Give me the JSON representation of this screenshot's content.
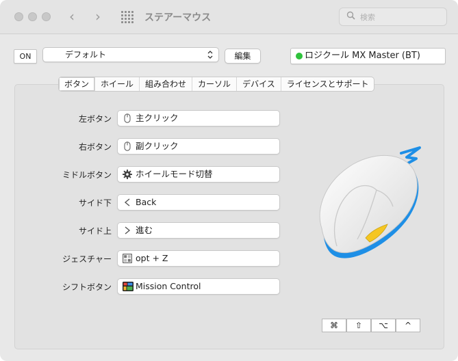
{
  "window": {
    "title": "ステアーマウス"
  },
  "search": {
    "placeholder": "検索"
  },
  "toolbar": {
    "on_label": "ON",
    "preset_value": "デフォルト",
    "edit_label": "編集",
    "device_name": "ロジクール MX Master (BT)",
    "device_status_color": "#2fc23c"
  },
  "tabs": [
    {
      "label": "ボタン",
      "active": true
    },
    {
      "label": "ホイール",
      "active": false
    },
    {
      "label": "組み合わせ",
      "active": false
    },
    {
      "label": "カーソル",
      "active": false
    },
    {
      "label": "デバイス",
      "active": false
    },
    {
      "label": "ライセンスとサポート",
      "active": false
    }
  ],
  "buttons": [
    {
      "label": "左ボタン",
      "action": "主クリック",
      "icon": "mouse-icon"
    },
    {
      "label": "右ボタン",
      "action": "副クリック",
      "icon": "mouse-icon"
    },
    {
      "label": "ミドルボタン",
      "action": "ホイールモード切替",
      "icon": "gear-icon"
    },
    {
      "label": "サイド下",
      "action": "Back",
      "icon": "chevron-left-icon"
    },
    {
      "label": "サイド上",
      "action": "進む",
      "icon": "chevron-right-icon"
    },
    {
      "label": "ジェスチャー",
      "action": "opt + Z",
      "icon": "gesture-icon"
    },
    {
      "label": "シフトボタン",
      "action": "Mission Control",
      "icon": "mission-control-icon"
    }
  ],
  "modifier_keys": [
    "⌘",
    "⇧",
    "⌥",
    "^"
  ]
}
